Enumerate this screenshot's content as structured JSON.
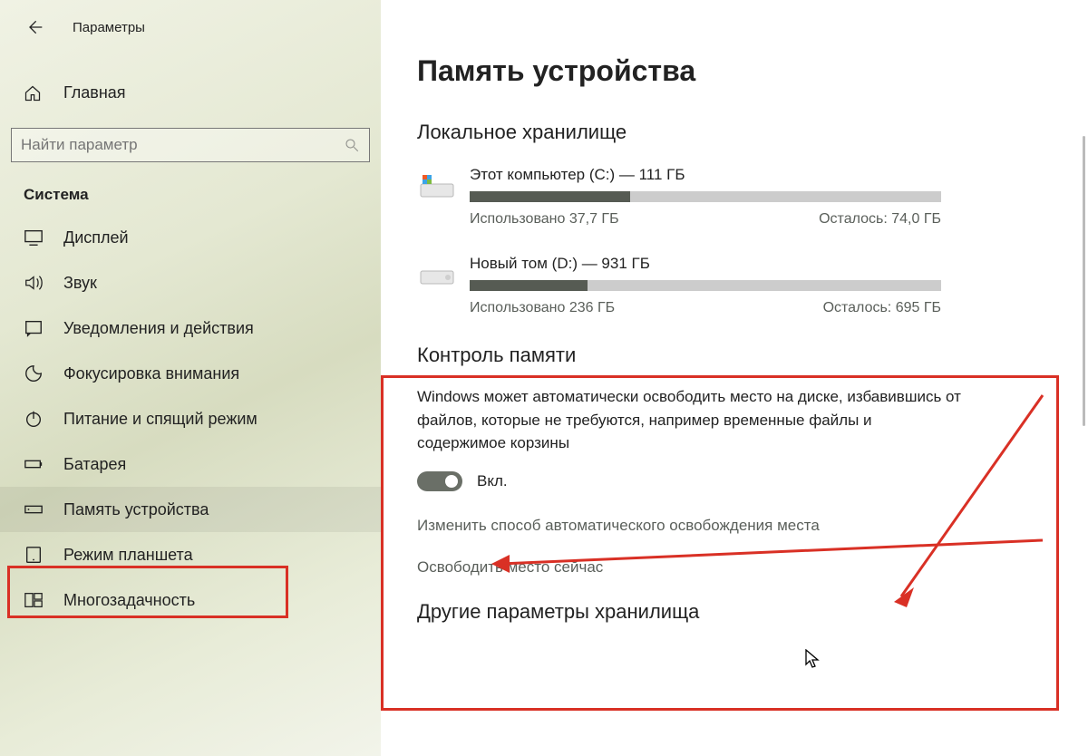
{
  "app": {
    "title": "Параметры"
  },
  "sidebar": {
    "home": "Главная",
    "search_placeholder": "Найти параметр",
    "group": "Система",
    "items": [
      {
        "label": "Дисплей"
      },
      {
        "label": "Звук"
      },
      {
        "label": "Уведомления и действия"
      },
      {
        "label": "Фокусировка внимания"
      },
      {
        "label": "Питание и спящий режим"
      },
      {
        "label": "Батарея"
      },
      {
        "label": "Память устройства"
      },
      {
        "label": "Режим планшета"
      },
      {
        "label": "Многозадачность"
      }
    ]
  },
  "page": {
    "title": "Память устройства",
    "local_title": "Локальное хранилище",
    "drives": [
      {
        "name": "Этот компьютер (C:) — 111 ГБ",
        "used": "Использовано 37,7 ГБ",
        "free": "Осталось: 74,0 ГБ",
        "pct": 34
      },
      {
        "name": "Новый том (D:) — 931 ГБ",
        "used": "Использовано 236 ГБ",
        "free": "Осталось: 695 ГБ",
        "pct": 25
      }
    ],
    "ctrl": {
      "title": "Контроль памяти",
      "desc": "Windows может автоматически освободить место на диске, избавившись от файлов, которые не требуются, например временные файлы и содержимое корзины",
      "toggle_label": "Вкл.",
      "link1": "Изменить способ автоматического освобождения места",
      "link2": "Освободить место сейчас"
    },
    "other_title": "Другие параметры хранилища"
  }
}
